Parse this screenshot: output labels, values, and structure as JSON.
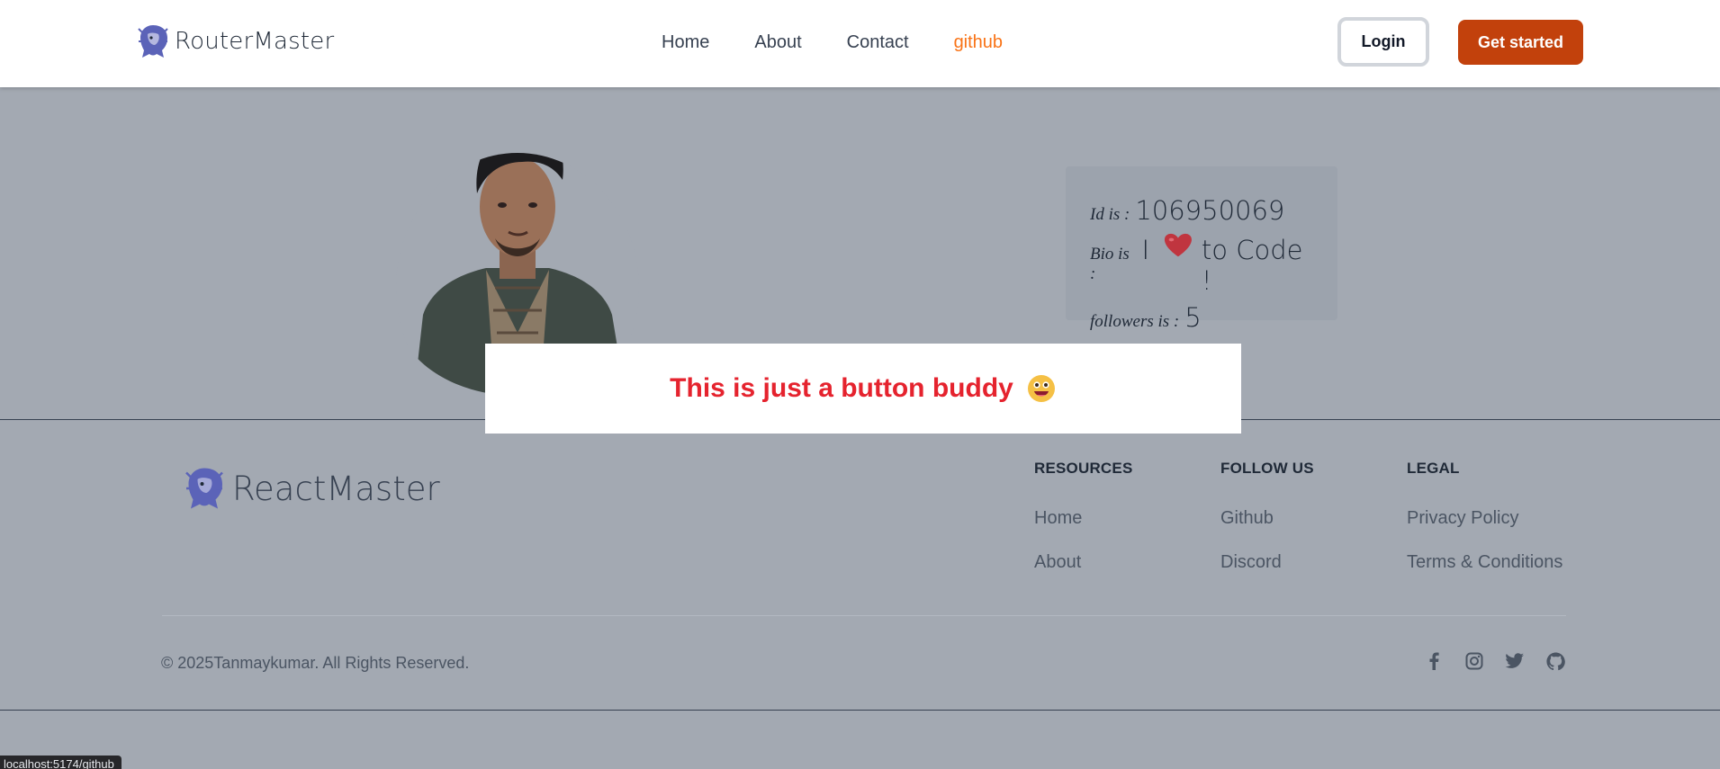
{
  "header": {
    "brand": "RouterMaster",
    "nav": [
      {
        "label": "Home",
        "active": false
      },
      {
        "label": "About",
        "active": false
      },
      {
        "label": "Contact",
        "active": false
      },
      {
        "label": "github",
        "active": true
      }
    ],
    "login_label": "Login",
    "get_started_label": "Get started"
  },
  "profile": {
    "id_label": "Id is :",
    "id_value": "106950069",
    "bio_label": "Bio is :",
    "bio_prefix": "I",
    "bio_suffix": "to Code !",
    "followers_label": "followers is :",
    "followers_value": "5",
    "avatar_icon": "profile-photo"
  },
  "center_button": {
    "label": "This is just a button buddy",
    "emoji": "grinning-face-emoji"
  },
  "footer": {
    "brand": "ReactMaster",
    "columns": [
      {
        "title": "RESOURCES",
        "links": [
          "Home",
          "About"
        ]
      },
      {
        "title": "FOLLOW US",
        "links": [
          "Github",
          "Discord"
        ]
      },
      {
        "title": "LEGAL",
        "links": [
          "Privacy Policy",
          "Terms & Conditions"
        ]
      }
    ],
    "copyright": "© 2025Tanmaykumar. All Rights Reserved.",
    "socials": [
      "facebook-icon",
      "instagram-icon",
      "twitter-icon",
      "github-icon"
    ]
  },
  "status_url": "localhost:5174/github",
  "colors": {
    "accent": "#f97316",
    "primary_button": "#c2410c",
    "overlay_bg": "#a3a9b2",
    "button_text": "#e5232e"
  }
}
